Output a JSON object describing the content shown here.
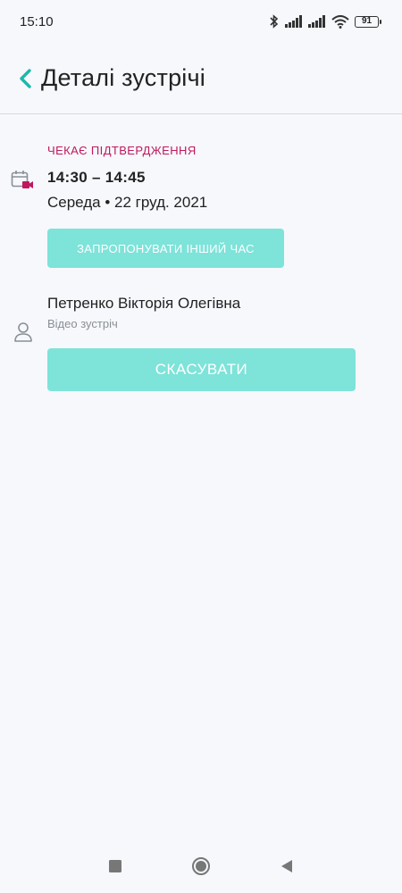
{
  "status_bar": {
    "time": "15:10",
    "battery": "91",
    "icons": [
      "bluetooth-icon",
      "signal-icon",
      "signal-icon",
      "wifi-icon",
      "battery-icon"
    ]
  },
  "header": {
    "title": "Деталі зустрічі",
    "back_icon": "chevron-left-icon",
    "accent_color": "#1bb9aa"
  },
  "appointment": {
    "status": "Чекає підтвердження",
    "status_color": "#c0185d",
    "time_range": "14:30 – 14:45",
    "date": "Середа • 22 груд. 2021",
    "propose_button": "Запропонувати інший час",
    "icon": "calendar-video-icon"
  },
  "participant": {
    "name": "Петренко Вікторія Олегівна",
    "meeting_type": "Відео зустріч",
    "icon": "person-icon"
  },
  "actions": {
    "cancel_button": "СКАСУВАТИ",
    "button_color": "#7ee3d9"
  },
  "nav": {
    "icons": [
      "recents-square-icon",
      "home-circle-icon",
      "back-triangle-icon"
    ]
  }
}
